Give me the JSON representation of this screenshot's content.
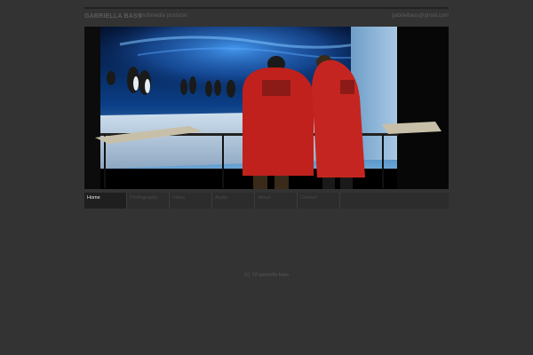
{
  "header": {
    "site_name": "GABRIELLA BASS",
    "tagline": "multimedia producer",
    "email": "gabrielbass@gmail.com"
  },
  "nav": {
    "items": [
      {
        "label": "Home",
        "active": true
      },
      {
        "label": "Photography",
        "active": false
      },
      {
        "label": "Video",
        "active": false
      },
      {
        "label": "Audio",
        "active": false
      },
      {
        "label": "About",
        "active": false
      },
      {
        "label": "Contact",
        "active": false
      }
    ]
  },
  "footer": {
    "copyright": "(c) '10 gabriella bass"
  },
  "colors": {
    "background": "#333333",
    "aurora": "#2f7fe0",
    "parka_red": "#c0211c"
  }
}
